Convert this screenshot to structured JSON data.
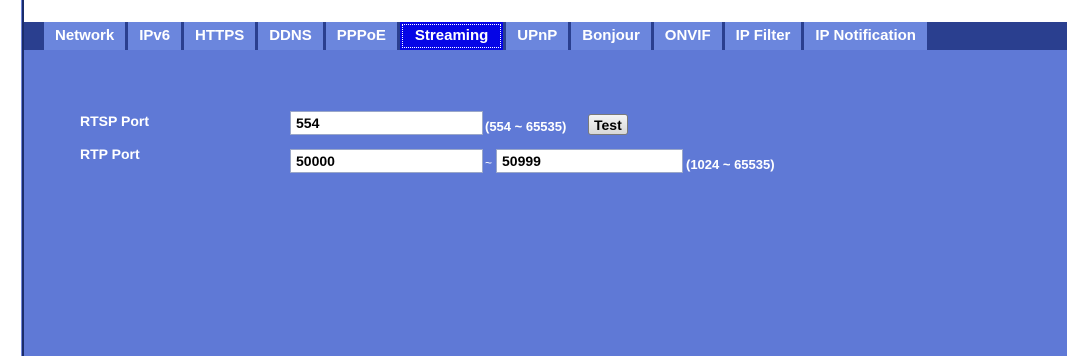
{
  "tabs": [
    {
      "label": "Network",
      "active": false
    },
    {
      "label": "IPv6",
      "active": false
    },
    {
      "label": "HTTPS",
      "active": false
    },
    {
      "label": "DDNS",
      "active": false
    },
    {
      "label": "PPPoE",
      "active": false
    },
    {
      "label": "Streaming",
      "active": true
    },
    {
      "label": "UPnP",
      "active": false
    },
    {
      "label": "Bonjour",
      "active": false
    },
    {
      "label": "ONVIF",
      "active": false
    },
    {
      "label": "IP Filter",
      "active": false
    },
    {
      "label": "IP Notification",
      "active": false
    }
  ],
  "form": {
    "rtsp_label": "RTSP Port",
    "rtsp_value": "554",
    "rtsp_range": "(554 ~ 65535)",
    "test_label": "Test",
    "rtp_label": "RTP Port",
    "rtp_start_value": "50000",
    "rtp_separator": "~",
    "rtp_end_value": "50999",
    "rtp_range": "(1024 ~ 65535)"
  },
  "colors": {
    "panel": "#5f79d6",
    "tab": "#6b86dd",
    "tab_active": "#0505e6",
    "tab_strip": "#2a3f8f"
  }
}
